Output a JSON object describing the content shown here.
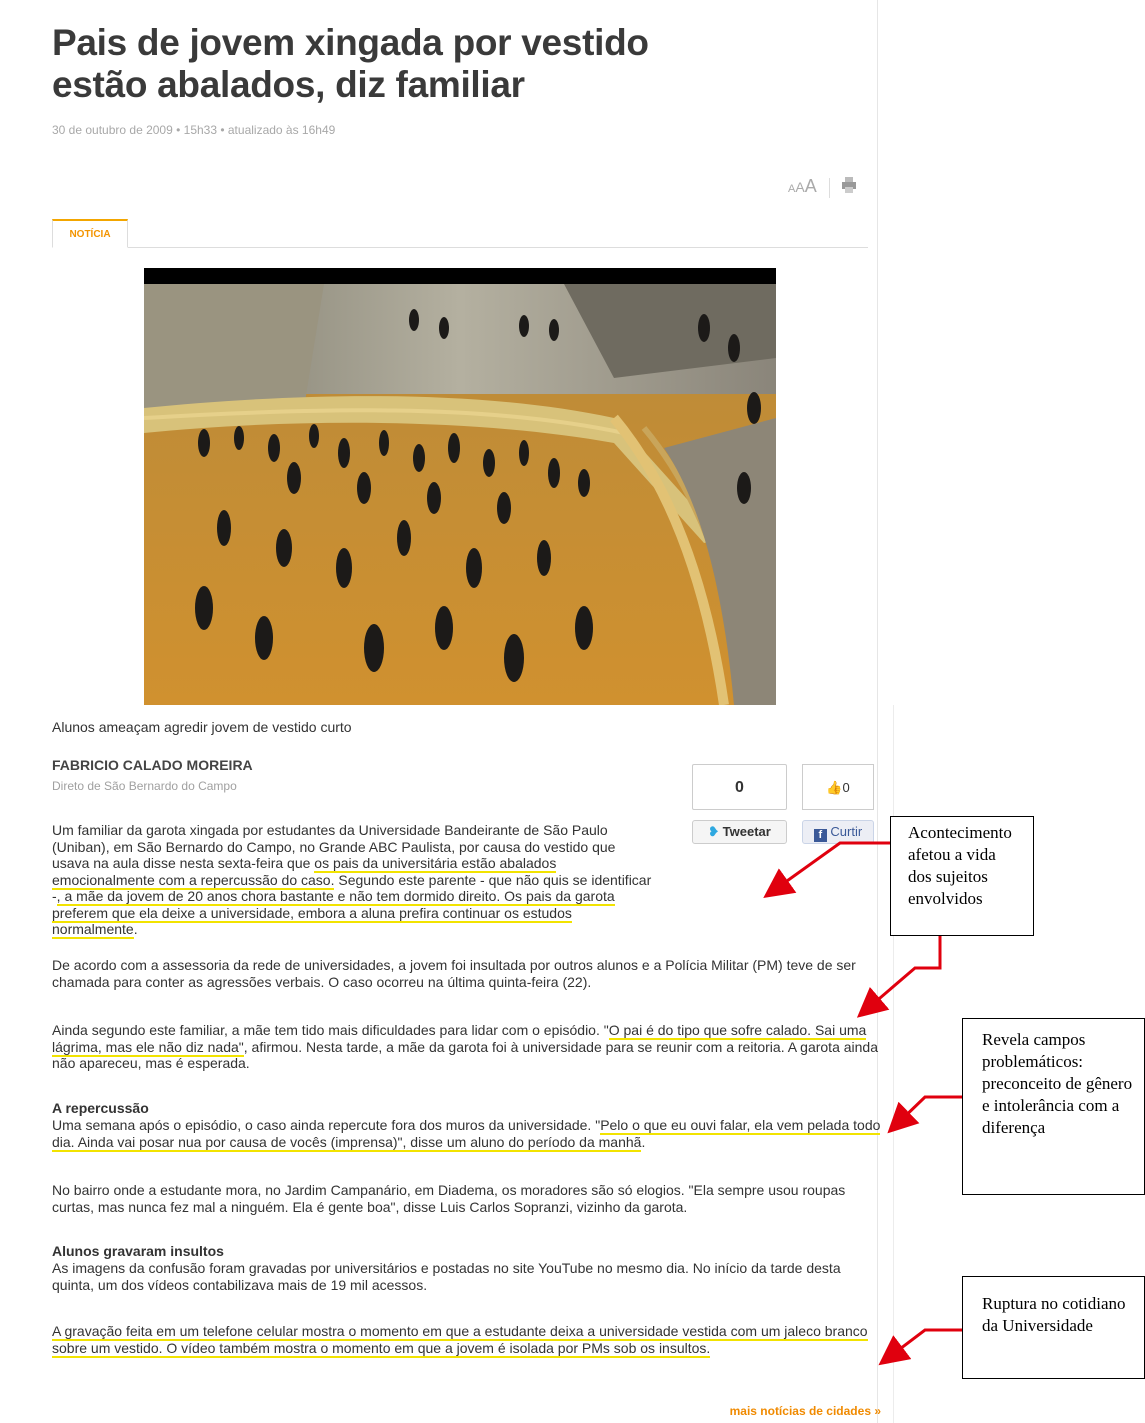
{
  "article": {
    "title": "Pais de jovem xingada por vestido estão abalados, diz familiar",
    "date": "30 de outubro de 2009 • 15h33 • atualizado às 16h49",
    "tab_label": "NOTÍCIA",
    "video_caption": "Alunos ameaçam agredir jovem de vestido curto",
    "author": "FABRICIO CALADO MOREIRA",
    "author_place": "Direto de São Bernardo do Campo",
    "p1_a": "Um familiar da garota xingada por estudantes da Universidade Bandeirante de São Paulo (Uniban), em São Bernardo do Campo, no Grande ABC Paulista, por causa do vestido que usava na aula disse nesta sexta-feira que",
    "p1_hl1": "os pais da universitária estão abalados emocionalmente com a repercussão do caso.",
    "p1_b": " Segundo este parente - que não quis se identificar -",
    "p1_hl2": ", a mãe da jovem de 20 anos chora bastante e não tem dormido direito. Os pais da garota preferem que ela deixe a universidade, embora a aluna prefira continuar os estudos normalmente",
    "p1_c": ".",
    "p2": "De acordo com a assessoria da rede de universidades, a jovem foi insultada por outros alunos e a Polícia Militar (PM) teve de ser chamada para conter as agressões verbais. O caso ocorreu na última quinta-feira (22).",
    "p3_a": "Ainda segundo este familiar, a mãe tem tido mais dificuldades para lidar com o episódio. \"",
    "p3_hl": "O pai é do tipo que sofre calado. Sai uma lágrima, mas ele não diz nada\"",
    "p3_b": ", afirmou. Nesta tarde, a mãe da garota foi à universidade para se reunir com a reitoria. A garota ainda não apareceu, mas é esperada.",
    "sub1": "A repercussão",
    "p4_a": "Uma semana após o episódio, o caso ainda repercute fora dos muros da universidade. \"",
    "p4_hl": "Pelo o que eu ouvi falar, ela vem pelada todo dia. Ainda vai posar nua por causa de vocês (imprensa)\", disse um aluno do período da manhã",
    "p4_b": ".",
    "p5": "No bairro onde a estudante mora, no Jardim Campanário, em Diadema, os moradores são só elogios. \"Ela sempre usou roupas curtas, mas nunca fez mal a ninguém. Ela é gente boa\", disse Luis Carlos Sopranzi, vizinho da garota.",
    "sub2": "Alunos gravaram insultos",
    "p6": "As imagens da confusão foram gravadas por universitários e postadas no site YouTube no mesmo dia. No início da tarde desta quinta, um dos vídeos contabilizava mais de 19 mil acessos.",
    "p7_hl": "A gravação feita em um telefone celular mostra o momento em que a estudante deixa a universidade vestida com um jaleco branco sobre um vestido. O vídeo também mostra o momento em que a jovem é isolada por PMs sob os insultos.",
    "more_link": "mais notícias de cidades »"
  },
  "tools": {
    "font_a1": "A",
    "font_a2": "A",
    "font_a3": "A",
    "print_icon": "printer-icon"
  },
  "social": {
    "tweet_count": "0",
    "tweet_label": "Tweetar",
    "like_count": "0",
    "like_label": "Curtir",
    "twitter_icon": "twitter-bird-icon",
    "facebook_icon": "facebook-icon",
    "thumb_icon": "thumbs-up-icon"
  },
  "annotations": [
    {
      "text": "Acontecimento afetou a vida dos sujeitos envolvidos"
    },
    {
      "text": "Revela campos problemáticos: preconceito de gênero e intolerância com a diferença"
    },
    {
      "text": "Ruptura no cotidiano da Universidade"
    }
  ],
  "colors": {
    "highlight": "#f2e300",
    "arrow": "#e0000e",
    "accent": "#f39400"
  }
}
